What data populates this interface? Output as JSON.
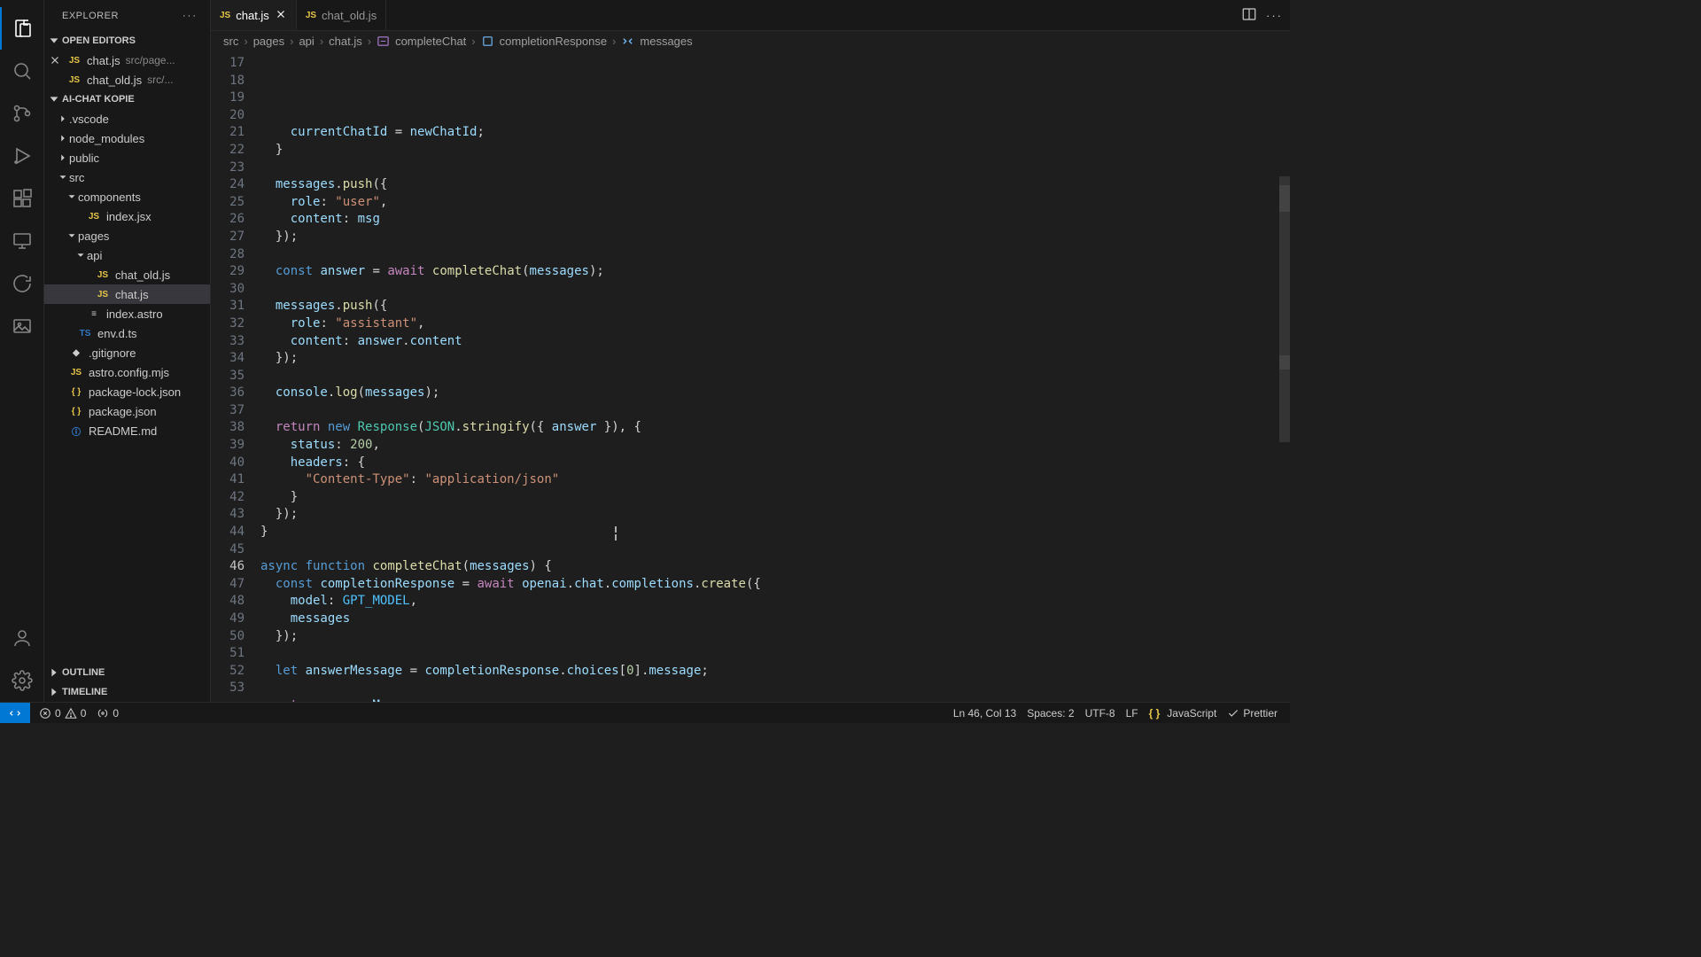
{
  "sidebar": {
    "title": "EXPLORER",
    "openEditors": {
      "title": "OPEN EDITORS",
      "items": [
        {
          "name": "chat.js",
          "desc": "src/page...",
          "modified": true
        },
        {
          "name": "chat_old.js",
          "desc": "src/...",
          "modified": false
        }
      ]
    },
    "folder": {
      "title": "AI-CHAT KOPIE",
      "tree": [
        {
          "indent": 1,
          "type": "folder",
          "open": false,
          "name": ".vscode"
        },
        {
          "indent": 1,
          "type": "folder",
          "open": false,
          "name": "node_modules"
        },
        {
          "indent": 1,
          "type": "folder",
          "open": false,
          "name": "public"
        },
        {
          "indent": 1,
          "type": "folder",
          "open": true,
          "name": "src"
        },
        {
          "indent": 2,
          "type": "folder",
          "open": true,
          "name": "components"
        },
        {
          "indent": 3,
          "type": "file",
          "ext": "js",
          "name": "index.jsx"
        },
        {
          "indent": 2,
          "type": "folder",
          "open": true,
          "name": "pages"
        },
        {
          "indent": 3,
          "type": "folder",
          "open": true,
          "name": "api"
        },
        {
          "indent": 4,
          "type": "file",
          "ext": "js",
          "name": "chat_old.js"
        },
        {
          "indent": 4,
          "type": "file",
          "ext": "js",
          "name": "chat.js",
          "active": true
        },
        {
          "indent": 3,
          "type": "file",
          "ext": "astro",
          "name": "index.astro"
        },
        {
          "indent": 2,
          "type": "file",
          "ext": "ts",
          "name": "env.d.ts"
        },
        {
          "indent": 1,
          "type": "file",
          "ext": "text",
          "name": ".gitignore",
          "dot": true
        },
        {
          "indent": 1,
          "type": "file",
          "ext": "js",
          "name": "astro.config.mjs"
        },
        {
          "indent": 1,
          "type": "file",
          "ext": "json",
          "name": "package-lock.json"
        },
        {
          "indent": 1,
          "type": "file",
          "ext": "json",
          "name": "package.json"
        },
        {
          "indent": 1,
          "type": "file",
          "ext": "info",
          "name": "README.md"
        }
      ]
    },
    "outline": "OUTLINE",
    "timeline": "TIMELINE"
  },
  "tabs": [
    {
      "name": "chat.js",
      "active": true
    },
    {
      "name": "chat_old.js",
      "active": false
    }
  ],
  "breadcrumbs": [
    "src",
    "pages",
    "api",
    "chat.js",
    "completeChat",
    "completionResponse",
    "messages"
  ],
  "code": {
    "start": 17,
    "currentLine": 46,
    "lines": [
      "",
      "    currentChatId = newChatId;",
      "  }",
      "",
      "  messages.push({",
      "    role: \"user\",",
      "    content: msg",
      "  });",
      "",
      "  const answer = await completeChat(messages);",
      "",
      "  messages.push({",
      "    role: \"assistant\",",
      "    content: answer.content",
      "  });",
      "",
      "  console.log(messages);",
      "",
      "  return new Response(JSON.stringify({ answer }), {",
      "    status: 200,",
      "    headers: {",
      "      \"Content-Type\": \"application/json\"",
      "    }",
      "  });",
      "}",
      "",
      "async function completeChat(messages) {",
      "  const completionResponse = await openai.chat.completions.create({",
      "    model: GPT_MODEL,",
      "    messages",
      "  });",
      "",
      "  let answerMessage = completionResponse.choices[0].message;",
      "",
      "  return answerMessage;",
      "}",
      ""
    ]
  },
  "status": {
    "errors": "0",
    "warnings": "0",
    "ports": "0",
    "lncol": "Ln 46, Col 13",
    "spaces": "Spaces: 2",
    "encoding": "UTF-8",
    "eol": "LF",
    "lang": "JavaScript",
    "prettier": "Prettier"
  }
}
